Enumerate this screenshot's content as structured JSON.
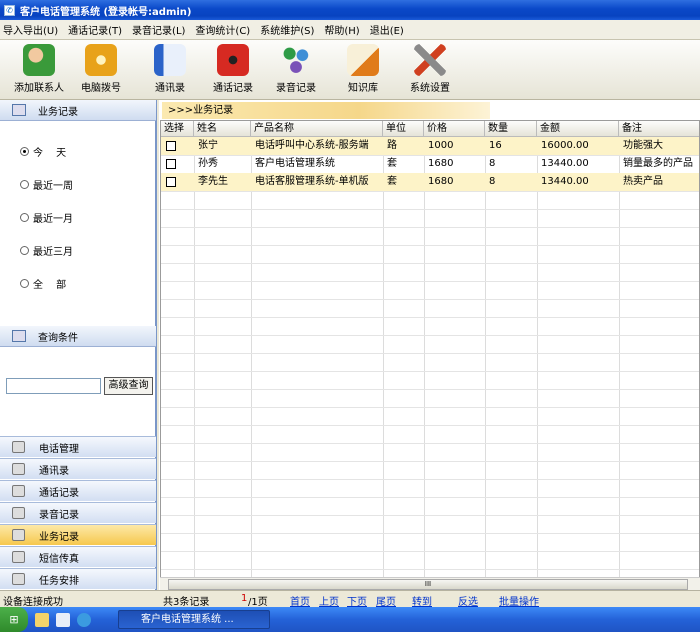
{
  "window": {
    "title": "客户电话管理系统 (登录帐号:admin)"
  },
  "menu": [
    "导入导出(U)",
    "通话记录(T)",
    "录音记录(L)",
    "查询统计(C)",
    "系统维护(S)",
    "帮助(H)",
    "退出(E)"
  ],
  "toolbar": [
    {
      "label": "添加联系人",
      "icon": "add-contact-icon",
      "color": "#3a9a3a"
    },
    {
      "label": "电脑拨号",
      "icon": "phone-dial-icon",
      "color": "#e8a21a"
    },
    {
      "label": "通讯录",
      "icon": "address-book-icon",
      "color": "#2b63c9"
    },
    {
      "label": "通话记录",
      "icon": "red-phone-icon",
      "color": "#d62a22"
    },
    {
      "label": "录音记录",
      "icon": "recording-icon",
      "color": "#3f8fd6"
    },
    {
      "label": "知识库",
      "icon": "knowledge-base-icon",
      "color": "#e07b1a"
    },
    {
      "label": "系统设置",
      "icon": "settings-tools-icon",
      "color": "#8a8a8a"
    }
  ],
  "sidebar": {
    "section_title": "业务记录",
    "date_options": [
      "今　 天",
      "最近一周",
      "最近一月",
      "最近三月",
      "全　 部"
    ],
    "selected_option": 0,
    "query_title": "查询条件",
    "search_value": "",
    "search_button": "高级查询",
    "nav": [
      {
        "label": "电话管理",
        "icon": "phone-icon"
      },
      {
        "label": "通讯录",
        "icon": "address-book-icon"
      },
      {
        "label": "通话记录",
        "icon": "call-log-icon"
      },
      {
        "label": "录音记录",
        "icon": "speaker-icon"
      },
      {
        "label": "业务记录",
        "icon": "business-record-icon",
        "active": true
      },
      {
        "label": "短信传真",
        "icon": "sms-fax-icon"
      },
      {
        "label": "任务安排",
        "icon": "task-icon"
      }
    ]
  },
  "main": {
    "breadcrumb": ">>>业务记录",
    "columns": [
      "选择",
      "姓名",
      "产品名称",
      "单位",
      "价格",
      "数量",
      "金额",
      "备注"
    ],
    "rows": [
      [
        "",
        "张宁",
        "电话呼叫中心系统-服务端",
        "路",
        "1000",
        "16",
        "16000.00",
        "功能强大"
      ],
      [
        "",
        "孙秀",
        "客户电话管理系统",
        "套",
        "1680",
        "8",
        "13440.00",
        "销量最多的产品"
      ],
      [
        "",
        "李先生",
        "电话客服管理系统-单机版",
        "套",
        "1680",
        "8",
        "13440.00",
        "热卖产品"
      ]
    ],
    "scroll_marker": "III"
  },
  "pager": {
    "total": "共3条记录",
    "page_current": "1",
    "page_total": "/1页",
    "first": "首页",
    "prev": "上页",
    "next": "下页",
    "last": "尾页",
    "goto": "转到",
    "invert": "反选",
    "batch": "批量操作"
  },
  "status": {
    "text": "设备连接成功"
  },
  "taskbar": {
    "task_label": "客户电话管理系统 ..."
  }
}
